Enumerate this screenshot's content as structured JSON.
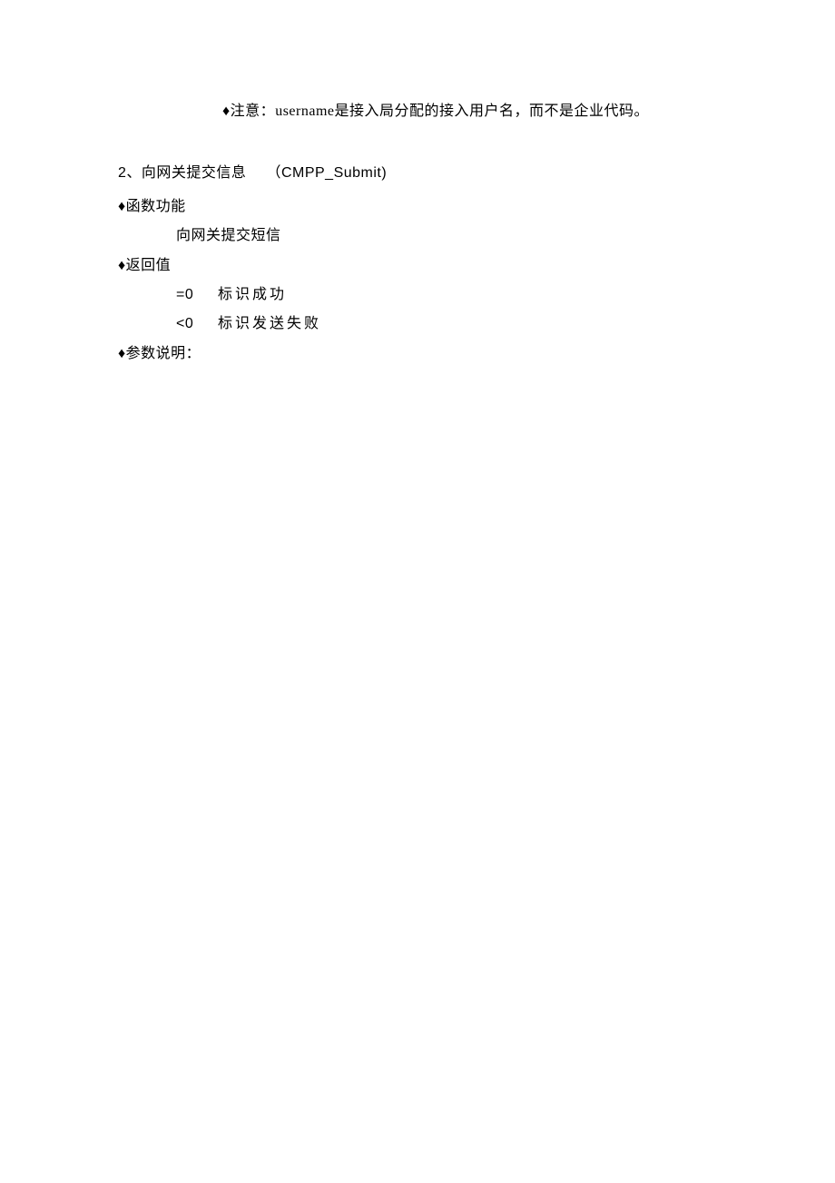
{
  "note": {
    "prefix": "♦",
    "label": "注意：",
    "text": "username是接入局分配的接入用户名，而不是企业代码。"
  },
  "section": {
    "number": "2",
    "sep": "、",
    "title": "向网关提交信息",
    "func_open": "（",
    "func_name": "CMPP_Submit)",
    "fields": [
      {
        "prefix": "♦",
        "label": "函数功能",
        "desc": "向网关提交短信"
      },
      {
        "prefix": "♦",
        "label": "返回值",
        "returns": [
          {
            "code": "=0",
            "desc": "标识成功"
          },
          {
            "code": "<0",
            "desc": "标识发送失败"
          }
        ]
      },
      {
        "prefix": "♦",
        "label": "参数说明：",
        "desc": ""
      }
    ]
  }
}
